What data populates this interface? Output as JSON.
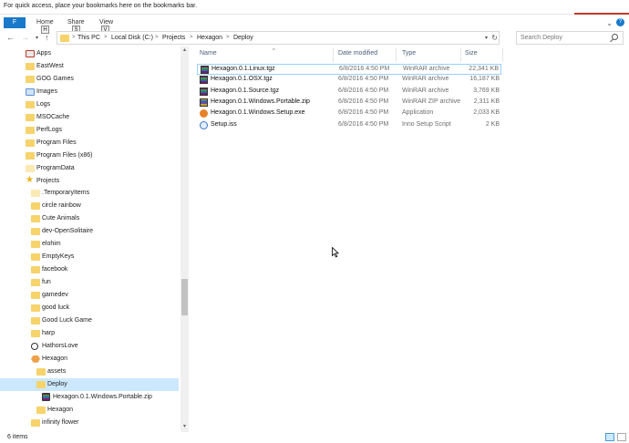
{
  "bookmarks_bar": {
    "text": "For quick access, place your bookmarks here on the bookmarks bar."
  },
  "ribbon": {
    "file_label": "F",
    "tabs": [
      {
        "label": "Home",
        "keytip": "H"
      },
      {
        "label": "Share",
        "keytip": "S"
      },
      {
        "label": "View",
        "keytip": "V"
      }
    ],
    "help_label": "?"
  },
  "address": {
    "crumbs": [
      "This PC",
      "Local Disk (C:)",
      "Projects",
      "Hexagon",
      "Deploy"
    ],
    "separator": ">"
  },
  "search": {
    "placeholder": "Search Deploy"
  },
  "nav_pane": {
    "items": [
      {
        "label": "Apps",
        "icon": "apps-icon",
        "level": 0,
        "selected": false
      },
      {
        "label": "EastWest",
        "icon": "folder-icon",
        "level": 0,
        "selected": false
      },
      {
        "label": "GOG Games",
        "icon": "folder-icon",
        "level": 0,
        "selected": false
      },
      {
        "label": "Images",
        "icon": "images-icon",
        "level": 0,
        "selected": false
      },
      {
        "label": "Logs",
        "icon": "folder-icon",
        "level": 0,
        "selected": false
      },
      {
        "label": "MSOCache",
        "icon": "folder-icon",
        "level": 0,
        "selected": false
      },
      {
        "label": "PerfLogs",
        "icon": "folder-icon",
        "level": 0,
        "selected": false
      },
      {
        "label": "Program Files",
        "icon": "folder-icon",
        "level": 0,
        "selected": false
      },
      {
        "label": "Program Files (x86)",
        "icon": "folder-icon",
        "level": 0,
        "selected": false
      },
      {
        "label": "ProgramData",
        "icon": "folder-light-icon",
        "level": 0,
        "selected": false
      },
      {
        "label": "Projects",
        "icon": "star-folder-icon",
        "level": 0,
        "selected": false
      },
      {
        "label": ".TemporaryItems",
        "icon": "folder-light-icon",
        "level": 1,
        "selected": false
      },
      {
        "label": "circle rainbow",
        "icon": "folder-icon",
        "level": 1,
        "selected": false
      },
      {
        "label": "Cute Animals",
        "icon": "folder-icon",
        "level": 1,
        "selected": false
      },
      {
        "label": "dev-OpenSolitaire",
        "icon": "folder-icon",
        "level": 1,
        "selected": false
      },
      {
        "label": "elohim",
        "icon": "folder-icon",
        "level": 1,
        "selected": false
      },
      {
        "label": "EmptyKeys",
        "icon": "folder-icon",
        "level": 1,
        "selected": false
      },
      {
        "label": "facebook",
        "icon": "folder-icon",
        "level": 1,
        "selected": false
      },
      {
        "label": "fun",
        "icon": "folder-icon",
        "level": 1,
        "selected": false
      },
      {
        "label": "gamedev",
        "icon": "folder-icon",
        "level": 1,
        "selected": false
      },
      {
        "label": "good luck",
        "icon": "folder-icon",
        "level": 1,
        "selected": false
      },
      {
        "label": "Good Luck Game",
        "icon": "folder-icon",
        "level": 1,
        "selected": false
      },
      {
        "label": "harp",
        "icon": "folder-icon",
        "level": 1,
        "selected": false
      },
      {
        "label": "HathorsLove",
        "icon": "hathor-icon",
        "level": 1,
        "selected": false
      },
      {
        "label": "Hexagon",
        "icon": "hexagon-icon",
        "level": 1,
        "selected": false
      },
      {
        "label": "assets",
        "icon": "folder-icon",
        "level": 2,
        "selected": false
      },
      {
        "label": "Deploy",
        "icon": "folder-icon",
        "level": 2,
        "selected": true
      },
      {
        "label": "Hexagon.0.1.Windows.Portable.zip",
        "icon": "zip-icon",
        "level": 3,
        "selected": false
      },
      {
        "label": "Hexagon",
        "icon": "folder-icon",
        "level": 2,
        "selected": false
      },
      {
        "label": "infinity flower",
        "icon": "folder-icon",
        "level": 1,
        "selected": false
      }
    ]
  },
  "columns": {
    "name": "Name",
    "date": "Date modified",
    "type": "Type",
    "size": "Size"
  },
  "files": [
    {
      "name": "Hexagon.0.1.Linux.tgz",
      "date": "6/8/2016 4:50 PM",
      "type": "WinRAR archive",
      "size": "22,341 KB",
      "icon": "rar"
    },
    {
      "name": "Hexagon.0.1.OSX.tgz",
      "date": "6/8/2016 4:50 PM",
      "type": "WinRAR archive",
      "size": "16,187 KB",
      "icon": "rar"
    },
    {
      "name": "Hexagon.0.1.Source.tgz",
      "date": "6/8/2016 4:50 PM",
      "type": "WinRAR archive",
      "size": "3,769 KB",
      "icon": "rar"
    },
    {
      "name": "Hexagon.0.1.Windows.Portable.zip",
      "date": "6/8/2016 4:50 PM",
      "type": "WinRAR ZIP archive",
      "size": "2,311 KB",
      "icon": "zip"
    },
    {
      "name": "Hexagon.0.1.Windows.Setup.exe",
      "date": "6/8/2016 4:50 PM",
      "type": "Application",
      "size": "2,033 KB",
      "icon": "exe"
    },
    {
      "name": "Setup.iss",
      "date": "6/8/2016 4:50 PM",
      "type": "Inno Setup Script",
      "size": "2 KB",
      "icon": "iss"
    }
  ],
  "status": {
    "count": "6 items"
  },
  "colors": {
    "accent": "#1979ca",
    "selection": "#cce8ff",
    "folder": "#f6d36b"
  }
}
